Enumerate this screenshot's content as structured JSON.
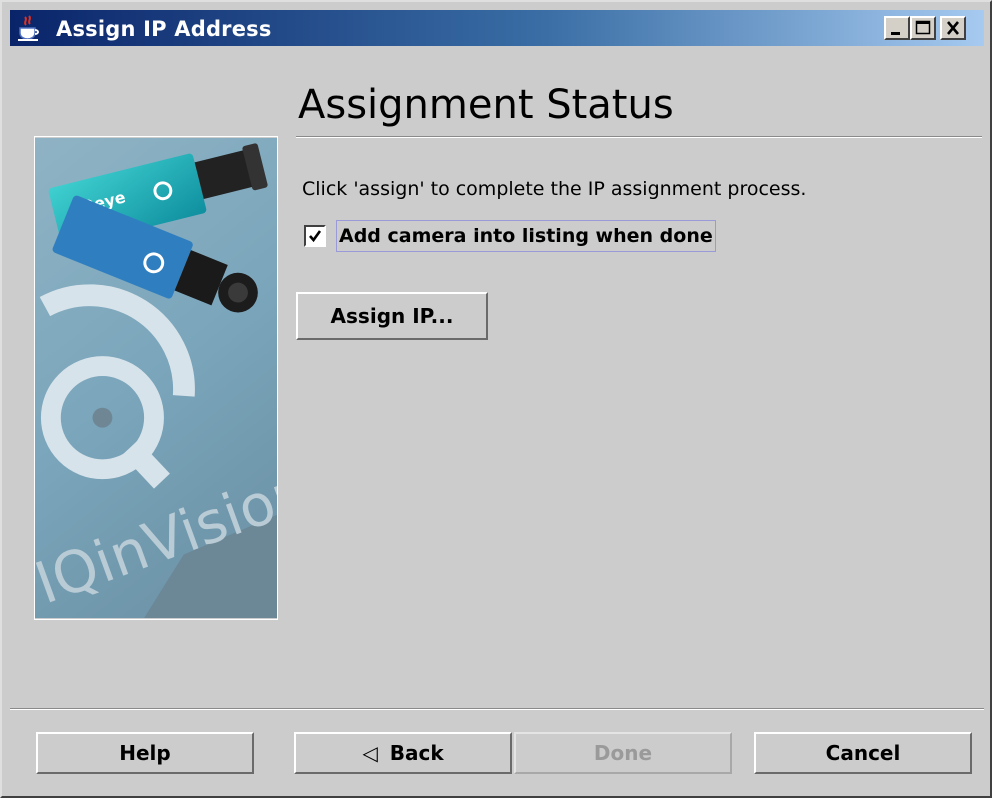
{
  "window": {
    "title": "Assign IP Address",
    "app_icon": "java-cup-icon",
    "controls": [
      "minimize-icon",
      "maximize-icon",
      "close-icon"
    ]
  },
  "side_image": {
    "brand_text": "IQinVision",
    "camera_label": "IQeye"
  },
  "main": {
    "heading": "Assignment Status",
    "instruction": "Click 'assign' to complete the IP assignment process.",
    "checkbox": {
      "label": "Add camera into listing when done",
      "checked": true
    },
    "assign_button": "Assign IP..."
  },
  "footer": {
    "help_label": "Help",
    "back_label": "Back",
    "back_icon": "left-arrow-icon",
    "done_label": "Done",
    "done_enabled": false,
    "cancel_label": "Cancel"
  },
  "colors": {
    "titlebar_start": "#0a246a",
    "titlebar_end": "#a6caf0",
    "background": "#cccccc",
    "focus_border": "#9a9ad8"
  }
}
